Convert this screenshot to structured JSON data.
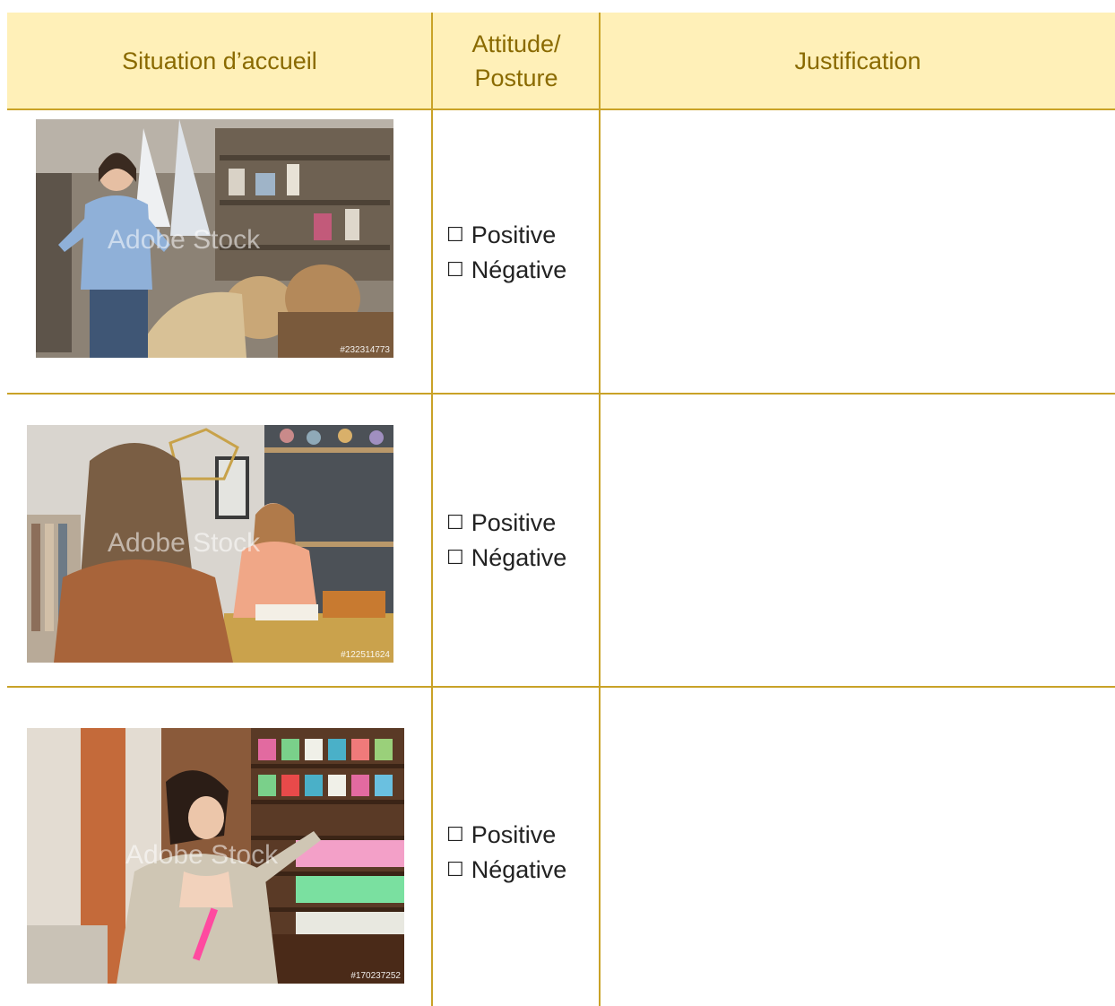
{
  "theme": {
    "header_bg": "#fff0b8",
    "header_text": "#8a6a00",
    "rule_color": "#c9a227"
  },
  "header": {
    "col1": "Situation d’accueil",
    "col2_line1": "Attitude/",
    "col2_line2": "Posture",
    "col3": "Justification"
  },
  "watermark": "Adobe Stock",
  "rows": [
    {
      "photo_id": "#232314773",
      "options": {
        "positive": "Positive",
        "negative": "Négative"
      },
      "justification": ""
    },
    {
      "photo_id": "#122511624",
      "options": {
        "positive": "Positive",
        "negative": "Négative"
      },
      "justification": ""
    },
    {
      "photo_id": "#170237252",
      "options": {
        "positive": "Positive",
        "negative": "Négative"
      },
      "justification": ""
    }
  ],
  "checkbox_glyph": "☐"
}
